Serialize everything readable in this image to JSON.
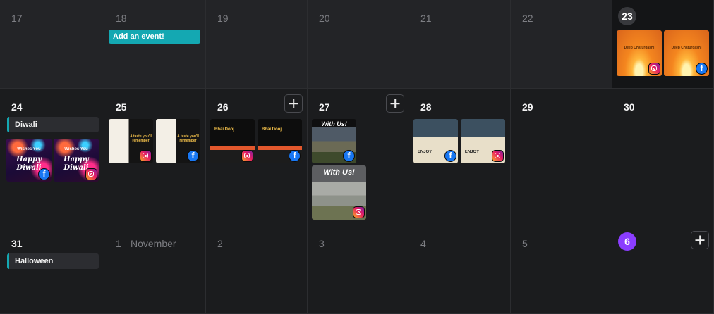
{
  "calendar": {
    "add_event_label": "Add an event!",
    "month_label": "November",
    "days": {
      "d17": "17",
      "d18": "18",
      "d19": "19",
      "d20": "20",
      "d21": "21",
      "d22": "22",
      "d23": "23",
      "d24": "24",
      "d25": "25",
      "d26": "26",
      "d27": "27",
      "d28": "28",
      "d29": "29",
      "d30": "30",
      "d31": "31",
      "d1": "1",
      "d2": "2",
      "d3": "3",
      "d4": "4",
      "d5": "5",
      "d6": "6"
    },
    "holidays": {
      "diwali": "Diwali",
      "halloween": "Halloween"
    },
    "posts": {
      "dhanteras": "Deep Chaturdashi",
      "diwali_line1": "Happy",
      "diwali_line2": "Diwali",
      "diwali_greeting": "Wishes You",
      "food_text": "A taste you'll remember",
      "bhai_text": "Bhai Dooj",
      "house_text": "With Us!",
      "enjoy_text": "ENJOY"
    },
    "colors": {
      "event_pill": "#14a8b2",
      "today_badge": "#8b3dff",
      "facebook": "#1877f2",
      "background": "#1b1c1e"
    },
    "icons": {
      "add": "plus-icon",
      "facebook": "facebook-icon",
      "instagram": "instagram-icon"
    }
  }
}
